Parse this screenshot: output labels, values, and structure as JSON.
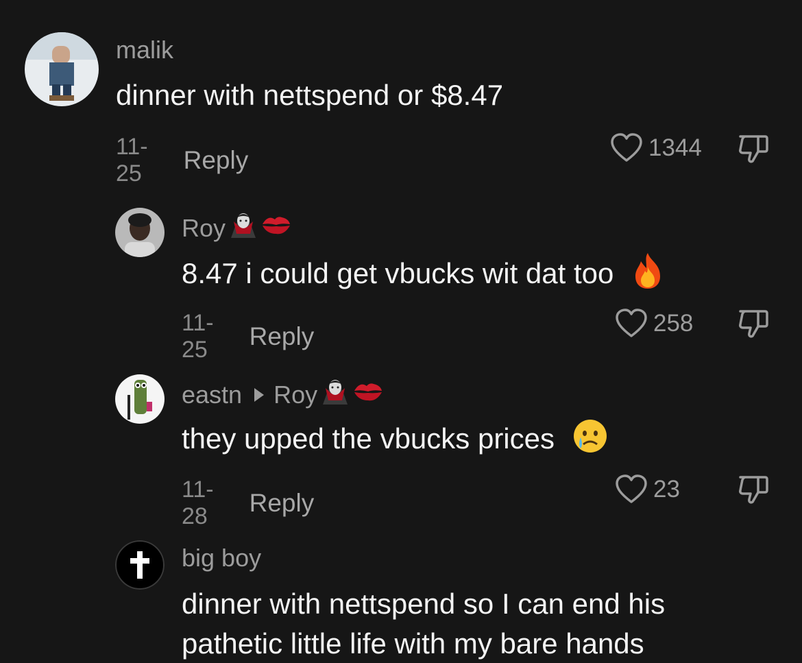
{
  "comments": [
    {
      "username": "malik",
      "text": "dinner with nettspend or $8.47",
      "date": "11-25",
      "reply_label": "Reply",
      "likes": "1344"
    },
    {
      "username": "Roy",
      "text": "8.47 i could get vbucks wit dat too",
      "date": "11-25",
      "reply_label": "Reply",
      "likes": "258"
    },
    {
      "username": "eastn",
      "reply_to": "Roy",
      "text": "they upped the vbucks prices",
      "date": "11-28",
      "reply_label": "Reply",
      "likes": "23"
    },
    {
      "username": "big boy",
      "text_line1": "dinner with nettspend so I can end his",
      "text_line2": "pathetic little life with my bare hands"
    }
  ],
  "icons": {
    "like": "heart-outline-icon",
    "dislike": "thumbs-down-outline-icon",
    "emoji_vampire": "vampire-emoji",
    "emoji_kiss": "kiss-mark-emoji",
    "emoji_fire": "fire-emoji",
    "emoji_cry": "crying-face-emoji"
  },
  "colors": {
    "background": "#161616",
    "text": "#f4f4f4",
    "muted": "#9c9c9c"
  }
}
